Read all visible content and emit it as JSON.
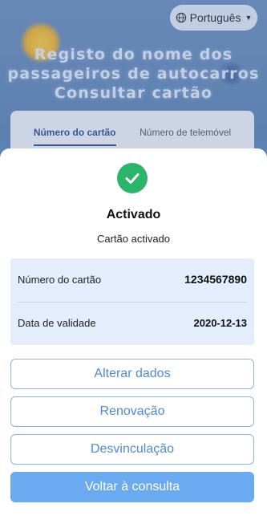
{
  "header": {
    "language_label": "Português",
    "language_icon": "globe-icon",
    "title_lines": [
      "Registo do nome dos",
      "passageiros de autocarros",
      "Consultar cartão"
    ]
  },
  "background_tabs": [
    {
      "label": "Número do cartão",
      "active": true
    },
    {
      "label": "Número de telemóvel",
      "active": false
    }
  ],
  "result": {
    "icon": "check-circle-icon",
    "icon_color": "#2bb56a",
    "title": "Activado",
    "subtitle": "Cartão activado",
    "rows": [
      {
        "label": "Número do cartão",
        "value": "1234567890"
      },
      {
        "label": "Data de validade",
        "value": "2020-12-13"
      }
    ]
  },
  "actions": {
    "edit_label": "Alterar dados",
    "renew_label": "Renovação",
    "unlink_label": "Desvinculação",
    "back_label": "Voltar à consulta"
  },
  "colors": {
    "accent": "#4f8ad6",
    "primary_button": "#6aaaf0",
    "info_background": "#e3edfb"
  }
}
